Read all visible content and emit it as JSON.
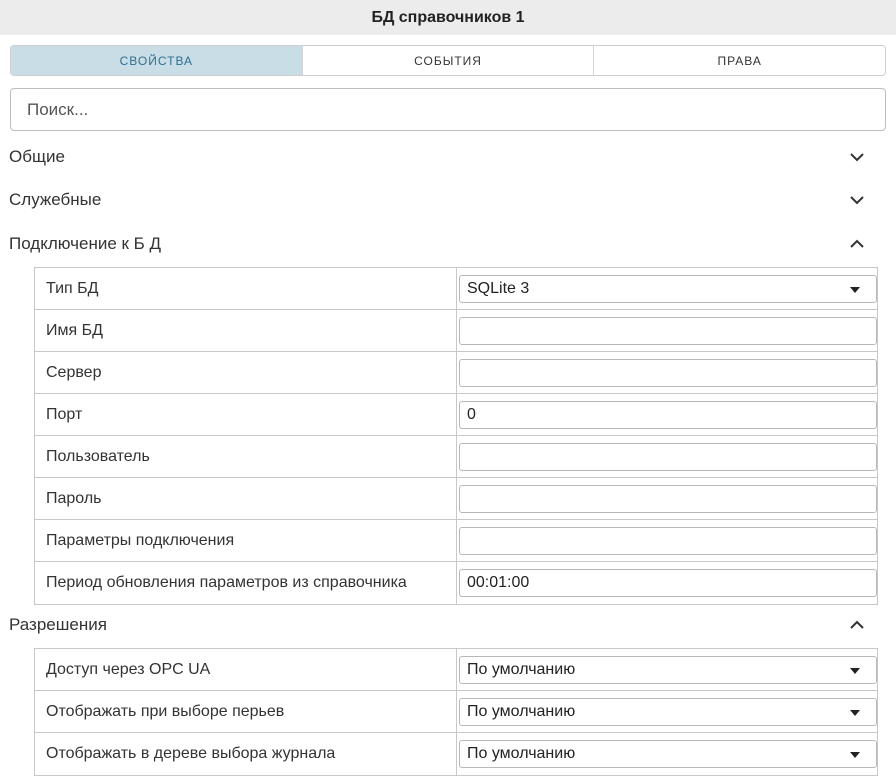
{
  "window": {
    "title": "БД справочников 1"
  },
  "tabs": [
    {
      "label": "СВОЙСТВА",
      "active": true
    },
    {
      "label": "СОБЫТИЯ",
      "active": false
    },
    {
      "label": "ПРАВА",
      "active": false
    }
  ],
  "search": {
    "placeholder": "Поиск..."
  },
  "sections": {
    "general": {
      "label": "Общие",
      "expanded": false
    },
    "service": {
      "label": "Служебные",
      "expanded": false
    },
    "connection": {
      "label": "Подключение к Б Д",
      "expanded": true,
      "rows": [
        {
          "label": "Тип БД",
          "value": "SQLite 3"
        },
        {
          "label": "Имя БД",
          "value": ""
        },
        {
          "label": "Сервер",
          "value": ""
        },
        {
          "label": "Порт",
          "value": "0"
        },
        {
          "label": "Пользователь",
          "value": ""
        },
        {
          "label": "Пароль",
          "value": ""
        },
        {
          "label": "Параметры подключения",
          "value": ""
        },
        {
          "label": "Период обновления параметров из справочника",
          "value": "00:01:00"
        }
      ]
    },
    "permissions": {
      "label": "Разрешения",
      "expanded": true,
      "rows": [
        {
          "label": "Доступ через OPC UA",
          "value": "По умолчанию"
        },
        {
          "label": "Отображать при выборе перьев",
          "value": "По умолчанию"
        },
        {
          "label": "Отображать в дереве выбора журнала",
          "value": "По умолчанию"
        }
      ]
    }
  },
  "colors": {
    "active_tab_bg": "#c8dde6",
    "active_tab_text": "#2f6f90",
    "titlebar_bg": "#ececec"
  }
}
